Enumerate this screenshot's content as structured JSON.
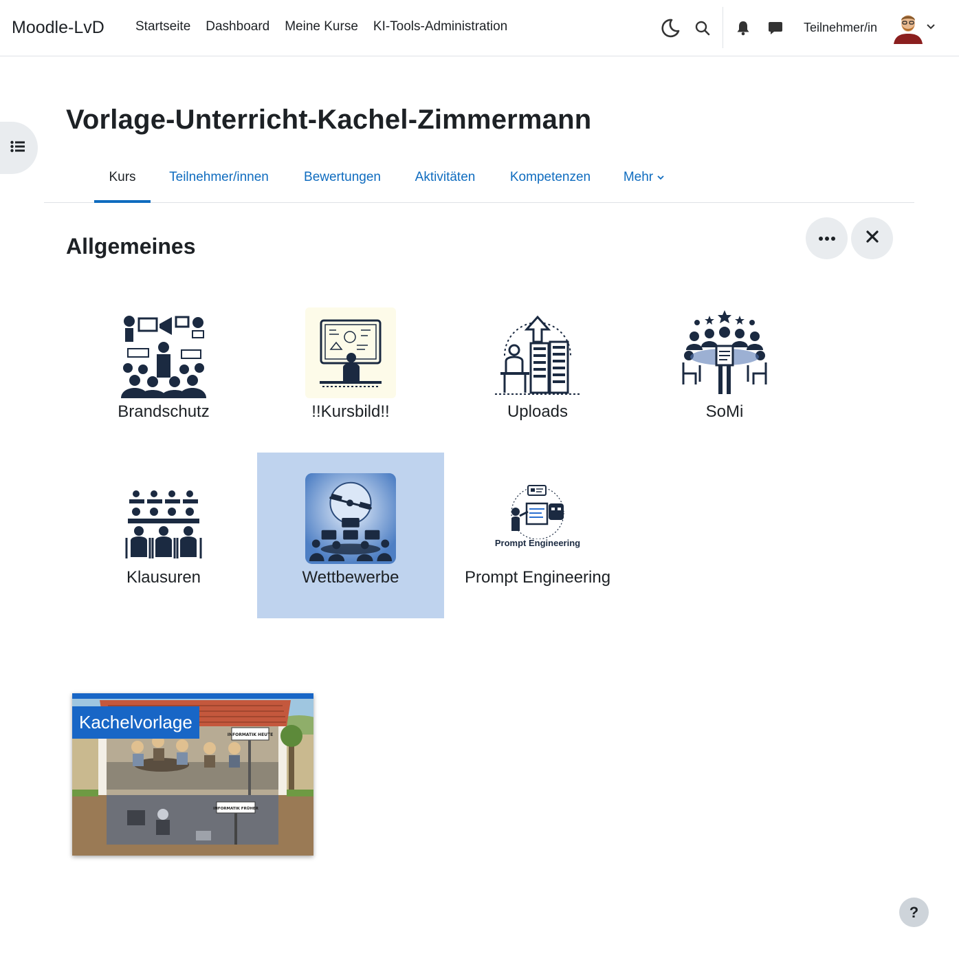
{
  "navbar": {
    "brand": "Moodle-LvD",
    "links": [
      "Startseite",
      "Dashboard",
      "Meine Kurse",
      "KI-Tools-Administration"
    ],
    "role": "Teilnehmer/in"
  },
  "page": {
    "title": "Vorlage-Unterricht-Kachel-Zimmermann"
  },
  "secondary_nav": {
    "tabs": [
      "Kurs",
      "Teilnehmer/innen",
      "Bewertungen",
      "Aktivitäten",
      "Kompetenzen",
      "Mehr"
    ],
    "active": "Kurs"
  },
  "section": {
    "title": "Allgemeines"
  },
  "tiles": [
    {
      "label": "Brandschutz",
      "selected": false
    },
    {
      "label": "!!Kursbild!!",
      "selected": false
    },
    {
      "label": "Uploads",
      "selected": false
    },
    {
      "label": "SoMi",
      "selected": false
    },
    {
      "label": "Klausuren",
      "selected": false
    },
    {
      "label": "Wettbewerbe",
      "selected": true
    },
    {
      "label": "Prompt Engineering",
      "selected": false,
      "image_caption": "Prompt Engineering"
    }
  ],
  "course_card": {
    "label": "Kachelvorlage",
    "sign_top": "INFORMATIK HEUTE",
    "sign_bottom": "INFORMATIK FRÜHER"
  },
  "help": {
    "label": "?"
  },
  "colors": {
    "link": "#0f6cbf",
    "selected_tile": "#bfd3ee",
    "card_label_bg": "#1866c6",
    "icon_dark": "#1b2a41"
  }
}
